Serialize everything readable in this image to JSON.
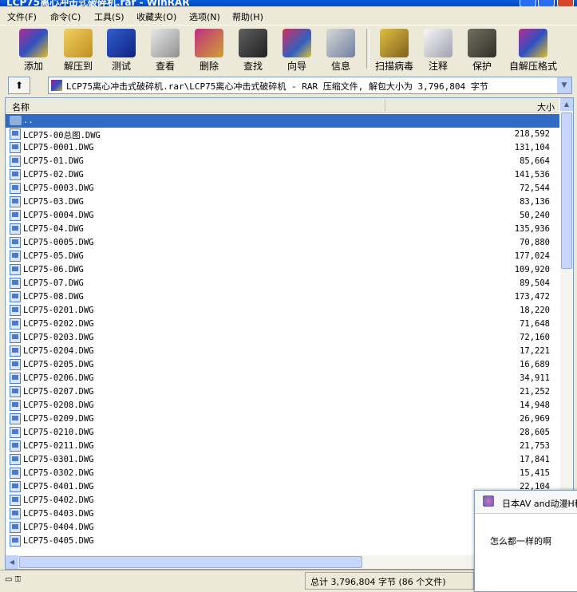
{
  "window": {
    "title": "LCP75离心冲击式破碎机.rar - WinRAR"
  },
  "menu": [
    "文件(F)",
    "命令(C)",
    "工具(S)",
    "收藏夹(O)",
    "选项(N)",
    "帮助(H)"
  ],
  "toolbar": [
    {
      "label": "添加",
      "icon": "add-books-icon"
    },
    {
      "label": "解压到",
      "icon": "extract-folder-icon"
    },
    {
      "label": "测试",
      "icon": "test-check-icon"
    },
    {
      "label": "查看",
      "icon": "view-glasses-icon"
    },
    {
      "label": "删除",
      "icon": "delete-icon"
    },
    {
      "label": "查找",
      "icon": "find-binoculars-icon"
    },
    {
      "label": "向导",
      "icon": "wizard-icon"
    },
    {
      "label": "信息",
      "icon": "info-icon"
    },
    {
      "label": "扫描病毒",
      "icon": "scan-virus-icon"
    },
    {
      "label": "注释",
      "icon": "comment-icon"
    },
    {
      "label": "保护",
      "icon": "protect-shield-icon"
    },
    {
      "label": "自解压格式",
      "icon": "sfx-icon"
    }
  ],
  "address": {
    "up_label": "⬆",
    "path": "LCP75离心冲击式破碎机.rar\\LCP75离心冲击式破碎机 - RAR 压缩文件, 解包大小为 3,796,804 字节"
  },
  "columns": {
    "name": "名称",
    "size": "大小"
  },
  "parent_row": "..",
  "files": [
    {
      "name": "LCP75-00总图.DWG",
      "size": "218,592"
    },
    {
      "name": "LCP75-0001.DWG",
      "size": "131,104"
    },
    {
      "name": "LCP75-01.DWG",
      "size": "85,664"
    },
    {
      "name": "LCP75-02.DWG",
      "size": "141,536"
    },
    {
      "name": "LCP75-0003.DWG",
      "size": "72,544"
    },
    {
      "name": "LCP75-03.DWG",
      "size": "83,136"
    },
    {
      "name": "LCP75-0004.DWG",
      "size": "50,240"
    },
    {
      "name": "LCP75-04.DWG",
      "size": "135,936"
    },
    {
      "name": "LCP75-0005.DWG",
      "size": "70,880"
    },
    {
      "name": "LCP75-05.DWG",
      "size": "177,024"
    },
    {
      "name": "LCP75-06.DWG",
      "size": "109,920"
    },
    {
      "name": "LCP75-07.DWG",
      "size": "89,504"
    },
    {
      "name": "LCP75-08.DWG",
      "size": "173,472"
    },
    {
      "name": "LCP75-0201.DWG",
      "size": "18,220"
    },
    {
      "name": "LCP75-0202.DWG",
      "size": "71,648"
    },
    {
      "name": "LCP75-0203.DWG",
      "size": "72,160"
    },
    {
      "name": "LCP75-0204.DWG",
      "size": "17,221"
    },
    {
      "name": "LCP75-0205.DWG",
      "size": "16,689"
    },
    {
      "name": "LCP75-0206.DWG",
      "size": "34,911"
    },
    {
      "name": "LCP75-0207.DWG",
      "size": "21,252"
    },
    {
      "name": "LCP75-0208.DWG",
      "size": "14,948"
    },
    {
      "name": "LCP75-0209.DWG",
      "size": "26,969"
    },
    {
      "name": "LCP75-0210.DWG",
      "size": "28,605"
    },
    {
      "name": "LCP75-0211.DWG",
      "size": "21,753"
    },
    {
      "name": "LCP75-0301.DWG",
      "size": "17,841"
    },
    {
      "name": "LCP75-0302.DWG",
      "size": "15,415"
    },
    {
      "name": "LCP75-0401.DWG",
      "size": "22,104"
    },
    {
      "name": "LCP75-0402.DWG",
      "size": ""
    },
    {
      "name": "LCP75-0403.DWG",
      "size": ""
    },
    {
      "name": "LCP75-0404.DWG",
      "size": ""
    },
    {
      "name": "LCP75-0405.DWG",
      "size": ""
    }
  ],
  "status": {
    "summary": "总计 3,796,804 字节 (86 个文件)"
  },
  "popup": {
    "title": "日本AV and动漫H种",
    "message": "怎么都一样的啊"
  },
  "colors": {
    "selection": "#316ac5",
    "titlebar": "#0a5fd8"
  }
}
